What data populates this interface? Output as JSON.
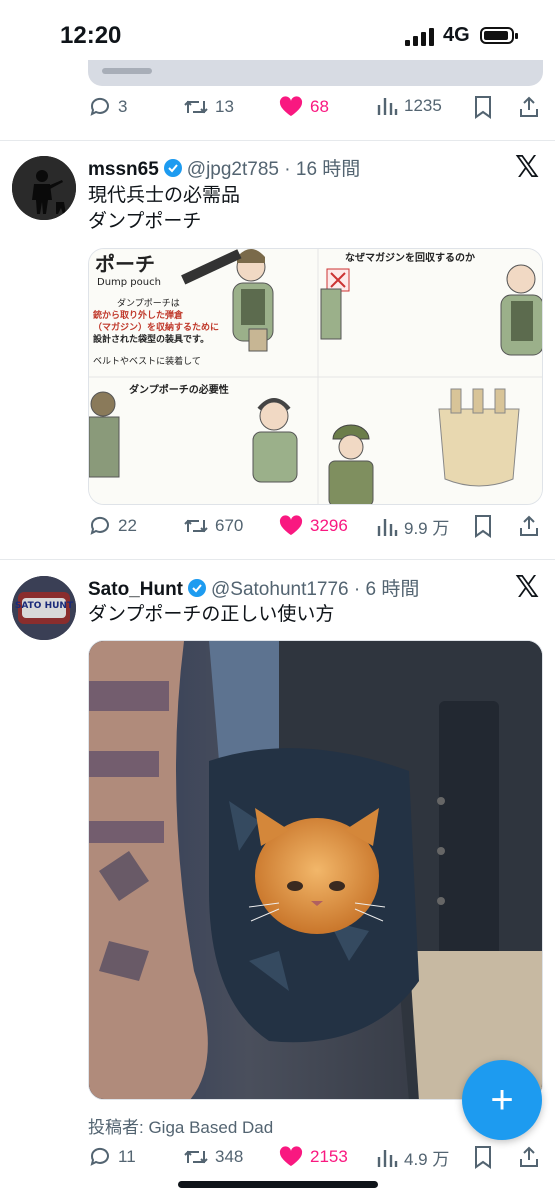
{
  "status_bar": {
    "time": "12:20",
    "network": "4G"
  },
  "prev_tweet": {
    "replies": "3",
    "retweets": "13",
    "likes": "68",
    "views": "1235"
  },
  "tweet1": {
    "name": "mssn65",
    "handle": "@jpg2t785",
    "time": "· 16 時間",
    "text_line1": "現代兵士の必需品",
    "text_line2": "ダンプポーチ",
    "media": {
      "title": "ポーチ",
      "subtitle": "Dump pouch",
      "p1": "ダンプポーチは",
      "p2": "銃から取り外した弾倉",
      "p3": "（マガジン）を収納するために",
      "p4": "設計された袋型の装具です。",
      "p5": "ベルトやベストに装着して",
      "q_title": "なぜマガジンを回収するのか",
      "n_title": "ダンプポーチの必要性"
    },
    "replies": "22",
    "retweets": "670",
    "likes": "3296",
    "views": "9.9 万"
  },
  "tweet2": {
    "name": "Sato_Hunt",
    "handle": "@Satohunt1776",
    "time": "· 6 時間",
    "text": "ダンプポーチの正しい使い方",
    "avatar_text": "SATO HUNT",
    "credit": "投稿者: Giga Based Dad",
    "replies": "11",
    "retweets": "348",
    "likes": "2153",
    "views": "4.9 万"
  },
  "fab": {
    "label": "+"
  },
  "colors": {
    "accent": "#1d9bf0",
    "like": "#f91880",
    "muted": "#536471"
  }
}
